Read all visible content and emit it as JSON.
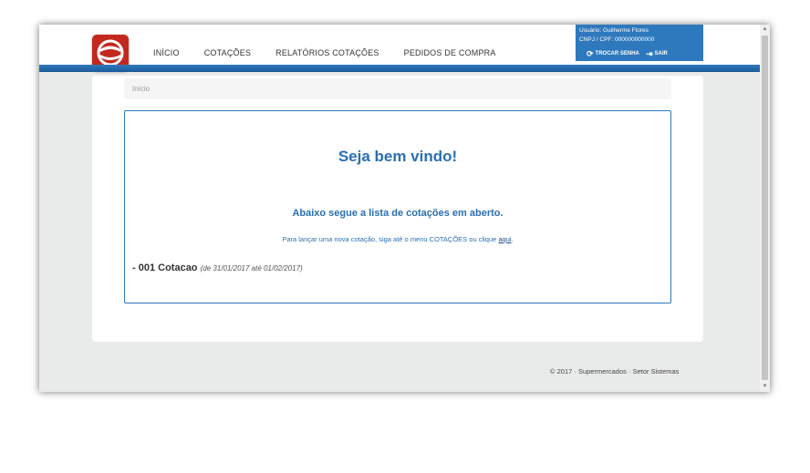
{
  "nav": {
    "items": [
      {
        "label": "INÍCIO"
      },
      {
        "label": "COTAÇÕES"
      },
      {
        "label": "RELATÓRIOS COTAÇÕES"
      },
      {
        "label": "PEDIDOS DE COMPRA"
      }
    ]
  },
  "user": {
    "name_line": "Usuário: Guilherme Flores",
    "company_line": "CNPJ / CPF: 000000000000",
    "change_label": "TROCAR SENHA",
    "logout_label": "SAIR"
  },
  "breadcrumb": {
    "current": "Início"
  },
  "welcome": {
    "title": "Seja bem vindo!",
    "list_intro": "Abaixo segue a lista de cotações em aberto.",
    "hint_prefix": "Para lançar uma nova cotação, siga até o menu COTAÇÕES ou clique ",
    "hint_link": "aqui",
    "hint_suffix": "."
  },
  "quotes": [
    {
      "prefix": "- 001 Cotacao",
      "dates": "(de 31/01/2017 até 01/02/2017)"
    }
  ],
  "footer": {
    "text": "© 2017 · Supermercados · Setor Sistemas"
  },
  "colors": {
    "brand_blue": "#2e78bd",
    "logo_red": "#c2281e"
  },
  "icons": {
    "logo": "logo-icon",
    "change_password": "key-icon",
    "logout": "logout-icon"
  }
}
